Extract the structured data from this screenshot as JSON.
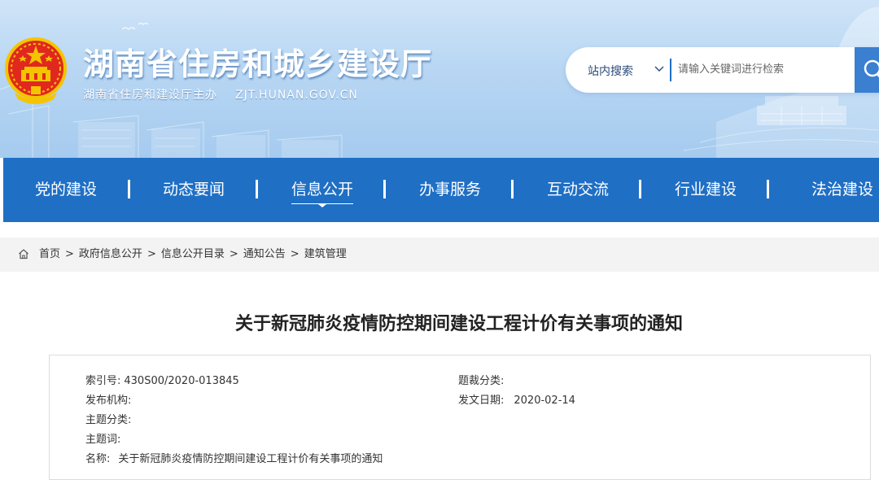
{
  "header": {
    "site_title": "湖南省住房和城乡建设厅",
    "host_text": "湖南省住房和建设厅主办",
    "domain_text": "ZJT.HUNAN.GOV.CN"
  },
  "search": {
    "scope_label": "站内搜索",
    "placeholder": "请输入关键词进行检索"
  },
  "nav": {
    "items": [
      {
        "label": "党的建设"
      },
      {
        "label": "动态要闻"
      },
      {
        "label": "信息公开"
      },
      {
        "label": "办事服务"
      },
      {
        "label": "互动交流"
      },
      {
        "label": "行业建设"
      },
      {
        "label": "法治建设"
      }
    ],
    "active_label": "信息公开"
  },
  "breadcrumb": {
    "items": [
      {
        "label": "首页"
      },
      {
        "label": "政府信息公开"
      },
      {
        "label": "信息公开目录"
      },
      {
        "label": "通知公告"
      },
      {
        "label": "建筑管理"
      }
    ],
    "separator": ">"
  },
  "article": {
    "title": "关于新冠肺炎疫情防控期间建设工程计价有关事项的通知"
  },
  "info": {
    "index_label": "索引号:",
    "index_value": "430S00/2020-013845",
    "genre_label": "题裁分类:",
    "genre_value": "",
    "publisher_label": "发布机构:",
    "publisher_value": "",
    "issue_date_label": "发文日期:",
    "issue_date_value": "2020-02-14",
    "topic_label": "主题分类:",
    "topic_value": "",
    "keywords_label": "主题词:",
    "keywords_value": "",
    "name_label": "名称:",
    "name_value": "关于新冠肺炎疫情防控期间建设工程计价有关事项的通知"
  },
  "colors": {
    "nav_bg": "#1f6fc5",
    "banner_top": "#cfe4f8",
    "banner_bottom": "#a6cbef",
    "search_accent": "#1d6fc4"
  },
  "icons": {
    "emblem": "national-emblem",
    "home": "home-icon",
    "search": "search-icon",
    "dropdown": "chevron-down-icon"
  }
}
